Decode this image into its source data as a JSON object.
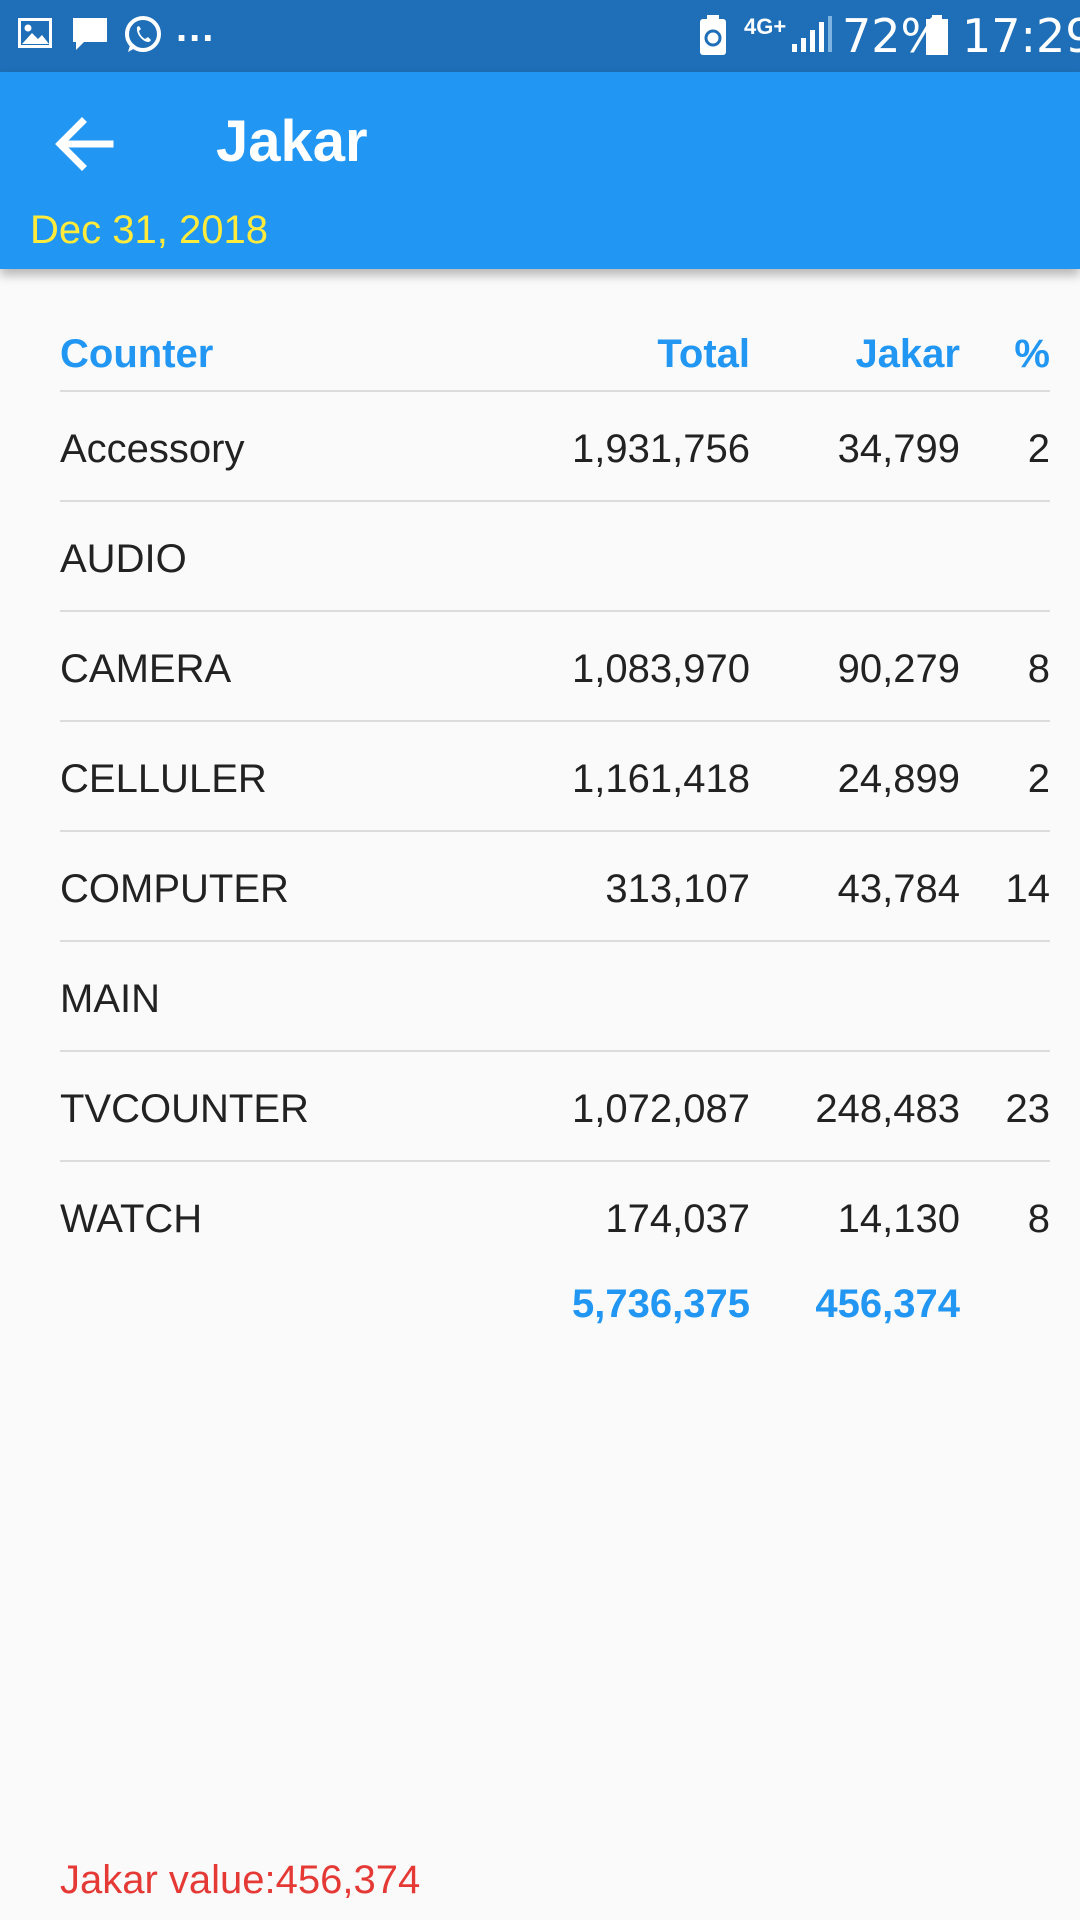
{
  "status_bar": {
    "battery_percent": "72%",
    "time": "17:29",
    "network": "4G+",
    "overflow": "...",
    "icons": [
      "image-icon",
      "chat-icon",
      "whatsapp-icon",
      "battery-saver-icon",
      "signal-icon",
      "battery-icon"
    ]
  },
  "app_bar": {
    "title": "Jakar",
    "subtitle": "Dec 31, 2018",
    "back_icon": "arrow-back-icon",
    "subtitle_color": "#ffeb3b",
    "color": "#2196f3"
  },
  "table": {
    "headers": {
      "counter": "Counter",
      "total": "Total",
      "jakar": "Jakar",
      "pct": "%"
    },
    "rows": [
      {
        "counter": "Accessory",
        "total": "1,931,756",
        "jakar": "34,799",
        "pct": "2"
      },
      {
        "counter": "AUDIO",
        "total": "",
        "jakar": "",
        "pct": ""
      },
      {
        "counter": "CAMERA",
        "total": "1,083,970",
        "jakar": "90,279",
        "pct": "8"
      },
      {
        "counter": "CELLULER",
        "total": "1,161,418",
        "jakar": "24,899",
        "pct": "2"
      },
      {
        "counter": "COMPUTER",
        "total": "313,107",
        "jakar": "43,784",
        "pct": "14"
      },
      {
        "counter": "MAIN",
        "total": "",
        "jakar": "",
        "pct": ""
      },
      {
        "counter": "TVCOUNTER",
        "total": "1,072,087",
        "jakar": "248,483",
        "pct": "23"
      },
      {
        "counter": "WATCH",
        "total": "174,037",
        "jakar": "14,130",
        "pct": "8"
      }
    ],
    "totals": {
      "total": "5,736,375",
      "jakar": "456,374"
    }
  },
  "footer_note": "Jakar value:456,374",
  "colors": {
    "accent": "#2196f3",
    "status_bar": "#1e6fb8",
    "note": "#e53935"
  }
}
